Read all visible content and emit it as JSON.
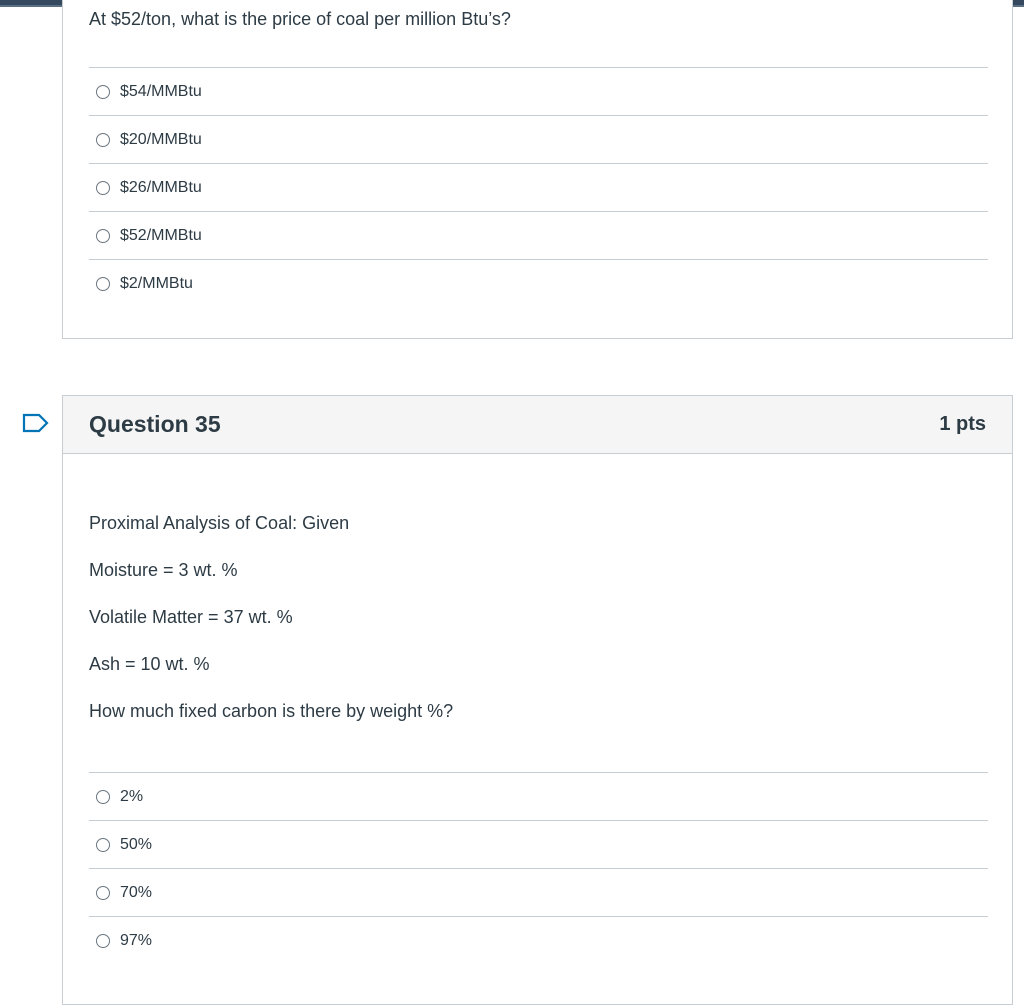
{
  "question34": {
    "text": "At $52/ton, what is the price of coal per million Btu’s?",
    "answers": [
      "$54/MMBtu",
      "$20/MMBtu",
      "$26/MMBtu",
      "$52/MMBtu",
      "$2/MMBtu"
    ]
  },
  "question35": {
    "title": "Question 35",
    "points": "1 pts",
    "body": [
      "Proximal Analysis of Coal: Given",
      "Moisture = 3 wt. %",
      "Volatile Matter = 37 wt. %",
      "Ash = 10 wt. %",
      "How much fixed carbon is there by weight %?"
    ],
    "answers": [
      "2%",
      "50%",
      "70%",
      "97%"
    ]
  },
  "icons": {
    "flag": "flag-question-icon",
    "radio": "radio-unchecked-icon"
  },
  "colors": {
    "text": "#2d3b45",
    "border": "#c7cdd1",
    "header_bg": "#f5f5f5",
    "flag": "#0374b5",
    "topbar": "#34495e"
  }
}
